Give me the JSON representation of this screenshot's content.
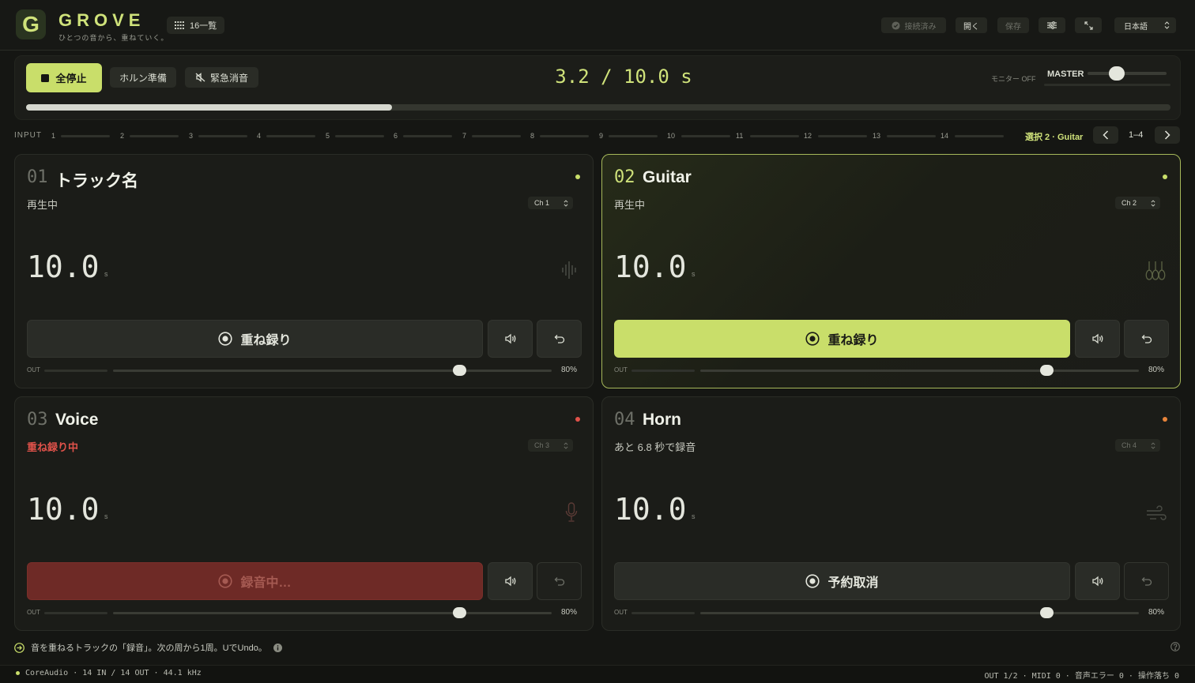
{
  "app": {
    "brand": "GROVE",
    "logo_letter": "G",
    "tagline": "ひとつの音から、重ねていく。"
  },
  "header": {
    "grid_button": "16一覧",
    "connected": "接続済み",
    "open": "開く",
    "save": "保存",
    "language": "日本語"
  },
  "transport": {
    "stop_all": "全停止",
    "horn_prep": "ホルン準備",
    "emergency_mute": "緊急消音",
    "timecode": "3.2 / 10.0 s",
    "monitor": "モニター OFF",
    "master_label": "MASTER",
    "master_level": 0.38,
    "progress": 0.32
  },
  "inputs": {
    "label": "INPUT",
    "channels": [
      "1",
      "2",
      "3",
      "4",
      "5",
      "6",
      "7",
      "8",
      "9",
      "10",
      "11",
      "12",
      "13",
      "14"
    ],
    "selection": "選択 2 · Guitar",
    "page_range": "1–4"
  },
  "tracks": [
    {
      "num": "01",
      "name": "トラック名",
      "status": "再生中",
      "channel": "Ch 1",
      "time": "10.0",
      "unit": "s",
      "action": "重ね録り",
      "out_label": "OUT",
      "volume_pct": "80%",
      "volume": 0.8,
      "icon": "waveform-icon",
      "dot_color": "#c9de6a"
    },
    {
      "num": "02",
      "name": "Guitar",
      "status": "再生中",
      "channel": "Ch 2",
      "time": "10.0",
      "unit": "s",
      "action": "重ね録り",
      "out_label": "OUT",
      "volume_pct": "80%",
      "volume": 0.8,
      "icon": "guitar-icon",
      "dot_color": "#c9de6a"
    },
    {
      "num": "03",
      "name": "Voice",
      "status": "重ね録り中",
      "channel": "Ch 3",
      "time": "10.0",
      "unit": "s",
      "action": "録音中…",
      "out_label": "OUT",
      "volume_pct": "80%",
      "volume": 0.8,
      "icon": "microphone-icon",
      "dot_color": "#e0524a"
    },
    {
      "num": "04",
      "name": "Horn",
      "status": "あと 6.8 秒で録音",
      "channel": "Ch 4",
      "time": "10.0",
      "unit": "s",
      "action": "予約取消",
      "out_label": "OUT",
      "volume_pct": "80%",
      "volume": 0.8,
      "icon": "wind-icon",
      "dot_color": "#e8843a"
    }
  ],
  "footer": {
    "hint": "音を重ねるトラックの「録音」。次の周から1周。UでUndo。",
    "status_left": "CoreAudio · 14 IN / 14 OUT · 44.1 kHz",
    "status_right": "OUT 1/2 · MIDI 0 · 音声エラー 0 · 操作落ち 0"
  },
  "colors": {
    "accent": "#c9de6a",
    "recording": "#e0524a",
    "armed": "#e8843a"
  }
}
